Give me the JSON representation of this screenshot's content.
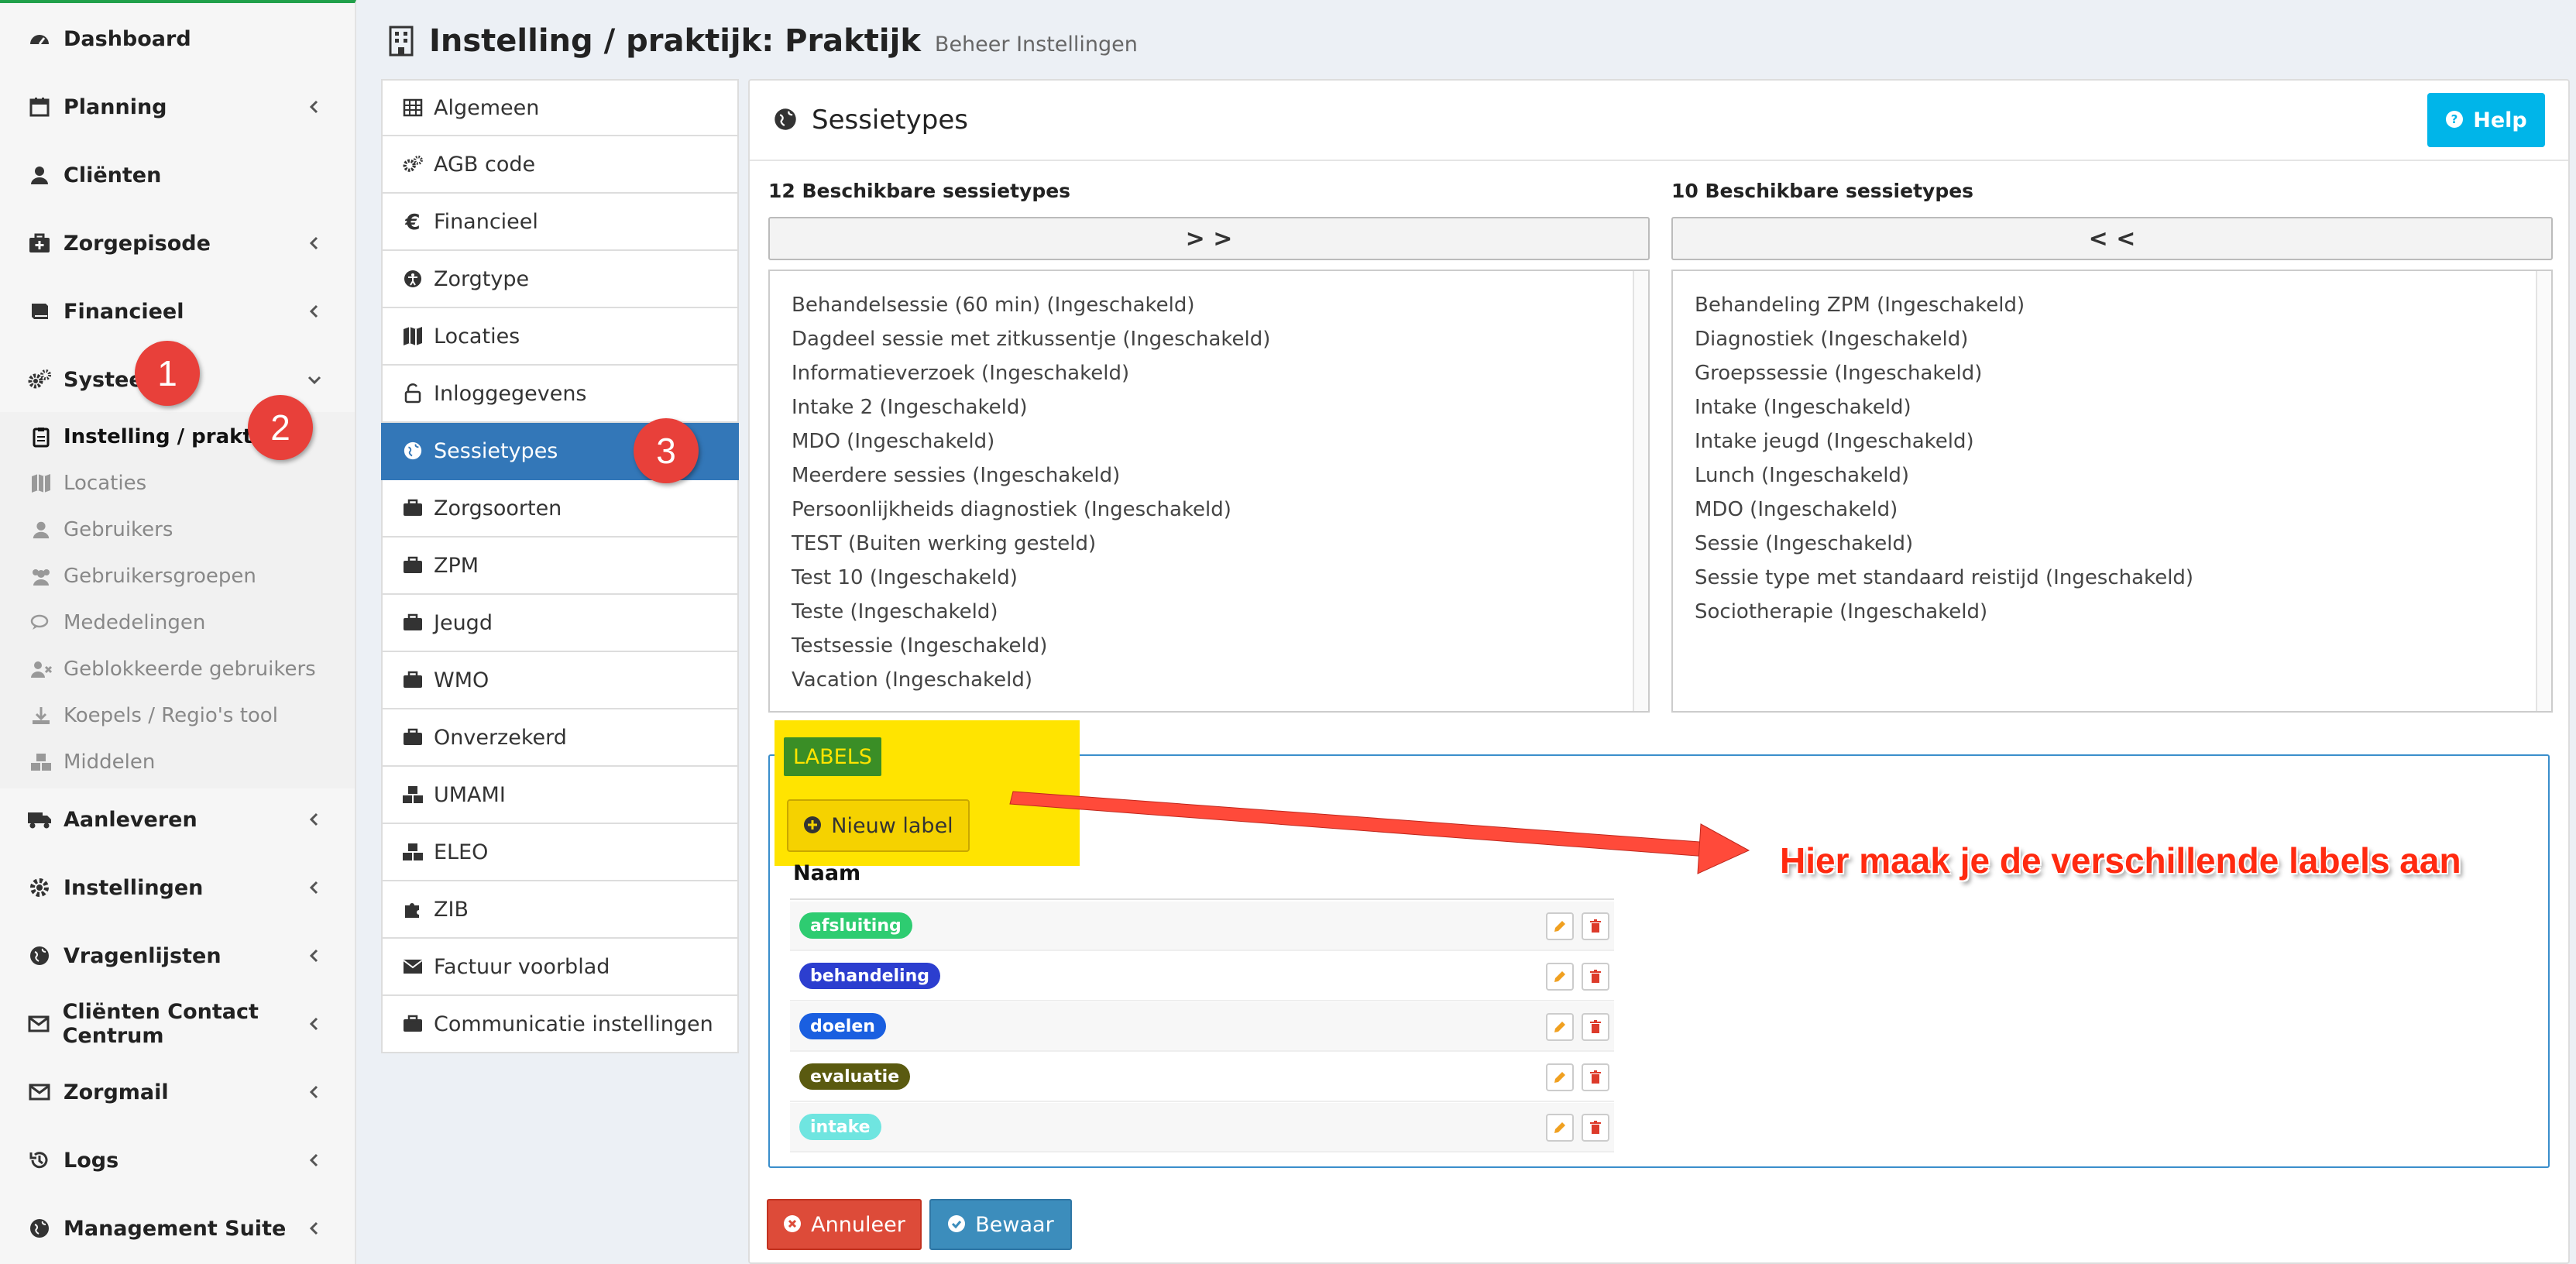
{
  "sidebar": {
    "items": [
      {
        "label": "Dashboard",
        "icon": "dashboard-icon",
        "chevron": false
      },
      {
        "label": "Planning",
        "icon": "calendar-icon",
        "chevron": true
      },
      {
        "label": "Cliënten",
        "icon": "user-icon",
        "chevron": false
      },
      {
        "label": "Zorgepisode",
        "icon": "medkit-icon",
        "chevron": true
      },
      {
        "label": "Financieel",
        "icon": "book-icon",
        "chevron": true
      },
      {
        "label": "Systeem",
        "icon": "cogs-icon",
        "chevron": "down"
      }
    ],
    "submenu": [
      {
        "label": "Instelling / praktijk",
        "icon": "clipboard-icon",
        "active": true
      },
      {
        "label": "Locaties",
        "icon": "map-icon"
      },
      {
        "label": "Gebruikers",
        "icon": "user-icon"
      },
      {
        "label": "Gebruikersgroepen",
        "icon": "users-icon"
      },
      {
        "label": "Mededelingen",
        "icon": "comments-icon"
      },
      {
        "label": "Geblokkeerde gebruikers",
        "icon": "user-times-icon"
      },
      {
        "label": "Koepels / Regio's tool",
        "icon": "download-icon"
      },
      {
        "label": "Middelen",
        "icon": "cubes-icon"
      }
    ],
    "items_bottom": [
      {
        "label": "Aanleveren",
        "icon": "truck-icon"
      },
      {
        "label": "Instellingen",
        "icon": "cog-icon"
      },
      {
        "label": "Vragenlijsten",
        "icon": "globe-icon"
      },
      {
        "label": "Cliënten Contact Centrum",
        "icon": "envelope-icon"
      },
      {
        "label": "Zorgmail",
        "icon": "envelope-icon"
      },
      {
        "label": "Logs",
        "icon": "history-icon"
      },
      {
        "label": "Management Suite",
        "icon": "globe-icon"
      }
    ]
  },
  "badges": [
    "1",
    "2",
    "3"
  ],
  "header": {
    "title": "Instelling / praktijk: Praktijk",
    "subtitle": "Beheer Instellingen"
  },
  "settings_nav": [
    {
      "label": "Algemeen",
      "icon": "table-icon"
    },
    {
      "label": "AGB code",
      "icon": "cogs-icon"
    },
    {
      "label": "Financieel",
      "icon": "euro-icon"
    },
    {
      "label": "Zorgtype",
      "icon": "universal-access-icon"
    },
    {
      "label": "Locaties",
      "icon": "map-icon"
    },
    {
      "label": "Inloggegevens",
      "icon": "unlock-icon"
    },
    {
      "label": "Sessietypes",
      "icon": "globe-icon",
      "active": true
    },
    {
      "label": "Zorgsoorten",
      "icon": "briefcase-icon"
    },
    {
      "label": "ZPM",
      "icon": "briefcase-icon"
    },
    {
      "label": "Jeugd",
      "icon": "briefcase-icon"
    },
    {
      "label": "WMO",
      "icon": "briefcase-icon"
    },
    {
      "label": "Onverzekerd",
      "icon": "briefcase-icon"
    },
    {
      "label": "UMAMI",
      "icon": "cubes-icon"
    },
    {
      "label": "ELEO",
      "icon": "cubes-icon"
    },
    {
      "label": "ZIB",
      "icon": "puzzle-icon"
    },
    {
      "label": "Factuur voorblad",
      "icon": "envelope-icon"
    },
    {
      "label": "Communicatie instellingen",
      "icon": "briefcase-icon"
    }
  ],
  "panel": {
    "title": "Sessietypes",
    "help_label": "Help",
    "left": {
      "title": "12 Beschikbare sessietypes",
      "button": "> >",
      "items": [
        "Behandelsessie (60 min) (Ingeschakeld)",
        "Dagdeel sessie met zitkussentje (Ingeschakeld)",
        "Informatieverzoek (Ingeschakeld)",
        "Intake 2 (Ingeschakeld)",
        "MDO (Ingeschakeld)",
        "Meerdere sessies (Ingeschakeld)",
        "Persoonlijkheids diagnostiek (Ingeschakeld)",
        "TEST (Buiten werking gesteld)",
        "Test 10 (Ingeschakeld)",
        "Teste (Ingeschakeld)",
        "Testsessie (Ingeschakeld)",
        "Vacation (Ingeschakeld)"
      ]
    },
    "right": {
      "title": "10 Beschikbare sessietypes",
      "button": "< <",
      "items": [
        "Behandeling ZPM (Ingeschakeld)",
        "Diagnostiek (Ingeschakeld)",
        "Groepssessie (Ingeschakeld)",
        "Intake (Ingeschakeld)",
        "Intake jeugd (Ingeschakeld)",
        "Lunch (Ingeschakeld)",
        "MDO (Ingeschakeld)",
        "Sessie (Ingeschakeld)",
        "Sessie type met standaard reistijd (Ingeschakeld)",
        "Sociotherapie (Ingeschakeld)"
      ]
    },
    "labels": {
      "heading": "LABELS",
      "new_label": "Nieuw label",
      "column": "Naam",
      "rows": [
        {
          "name": "afsluiting",
          "color": "#2ecc71"
        },
        {
          "name": "behandeling",
          "color": "#2c3ecf"
        },
        {
          "name": "doelen",
          "color": "#1a5fe0"
        },
        {
          "name": "evaluatie",
          "color": "#5a5a10"
        },
        {
          "name": "intake",
          "color": "#6fe5e0"
        }
      ]
    },
    "annotation": "Hier maak je de verschillende labels aan",
    "cancel_label": "Annuleer",
    "save_label": "Bewaar"
  }
}
